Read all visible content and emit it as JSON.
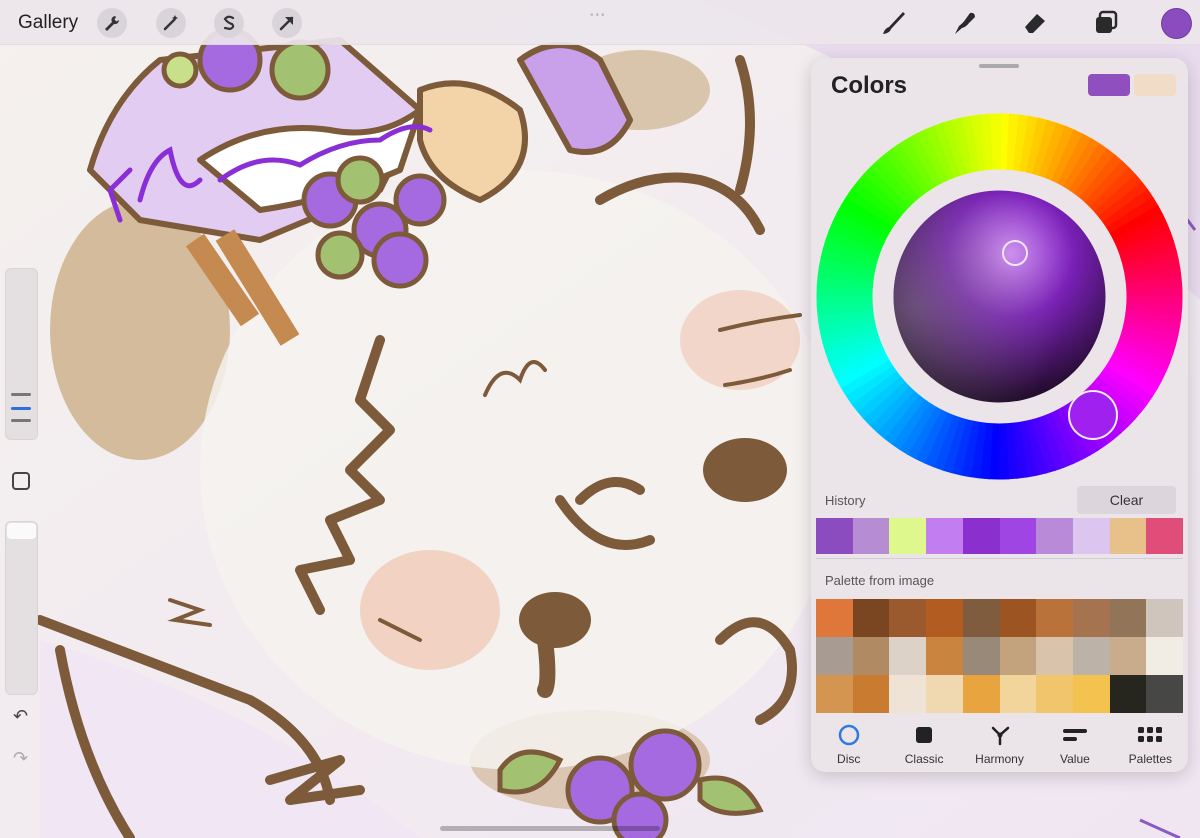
{
  "topbar": {
    "gallery_label": "Gallery",
    "left_tools": [
      "wrench-icon",
      "magic-wand-icon",
      "selection-icon",
      "transform-arrow-icon"
    ],
    "right_tools": [
      "brush-icon",
      "smudge-icon",
      "eraser-icon",
      "layers-icon"
    ],
    "active_color": "#8b4cc0"
  },
  "sidebar": {
    "brush_size_level": 0.3,
    "opacity_level": 1.0,
    "tools": [
      "modify-square-icon",
      "undo-icon",
      "redo-icon"
    ]
  },
  "colors_panel": {
    "title": "Colors",
    "current_color": "#8f4fbf",
    "previous_color": "#f1dcc8",
    "history_label": "History",
    "clear_label": "Clear",
    "history": [
      "#8b4cc0",
      "#b68dd3",
      "#def88e",
      "#c27ef0",
      "#8b2fcf",
      "#9e45e3",
      "#b98ad8",
      "#dcc6ef",
      "#e8c08a",
      "#e04d78"
    ],
    "palette_label": "Palette from image",
    "palette": [
      "#e0773a",
      "#7a4521",
      "#9a5a2e",
      "#b35c22",
      "#805c3f",
      "#9c5522",
      "#b8723a",
      "#a57350",
      "#927558",
      "#cfc5bd",
      "#a89c92",
      "#b08a63",
      "#ddd2c8",
      "#c9853f",
      "#988979",
      "#c3a27e",
      "#d9c4ab",
      "#bcb2a8",
      "#c9ac8b",
      "#f1ede5",
      "#d39550",
      "#c97c30",
      "#efe3d5",
      "#f0d9b0",
      "#e8a43f",
      "#f2d59a",
      "#f0c56c",
      "#f3c24f",
      "#26261f",
      "#474746"
    ],
    "tabs": [
      {
        "label": "Disc",
        "icon": "disc-circle-icon"
      },
      {
        "label": "Classic",
        "icon": "classic-square-icon"
      },
      {
        "label": "Harmony",
        "icon": "harmony-icon"
      },
      {
        "label": "Value",
        "icon": "value-bars-icon"
      },
      {
        "label": "Palettes",
        "icon": "palettes-grid-icon"
      }
    ],
    "active_tab": "Disc"
  }
}
